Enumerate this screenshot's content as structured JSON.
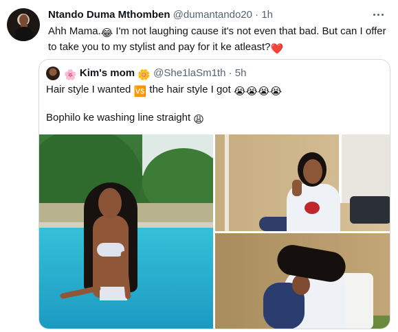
{
  "tweet": {
    "author_name": "Ntando Duma Mthomben",
    "author_handle": "@dumantando20",
    "separator": "·",
    "time": "1h",
    "text_part1": "Ahh Mama.",
    "emoji_joy": "😂",
    "text_part2": " I'm not laughing cause it's not even that bad. But can I offer to take you to my stylist and pay for it ke atleast?",
    "emoji_heart": "❤️"
  },
  "quoted": {
    "emoji_blossom": "🌸",
    "author_name": "Kim's mom",
    "emoji_daisy": "🌼",
    "author_handle": "@She1laSm1th",
    "separator": "·",
    "time": "5h",
    "line1_part1": "Hair style I wanted ",
    "emoji_vs": "🆚",
    "line1_part2": " the hair style I got ",
    "emoji_crying": "😭😭😭😭",
    "line2_text": "Bophilo ke washing line straight ",
    "emoji_tired": "😩"
  },
  "icons": {
    "more": "more-horizontal-icon"
  },
  "colors": {
    "text": "#0f1419",
    "secondary": "#536471",
    "border": "#cfd9de"
  }
}
